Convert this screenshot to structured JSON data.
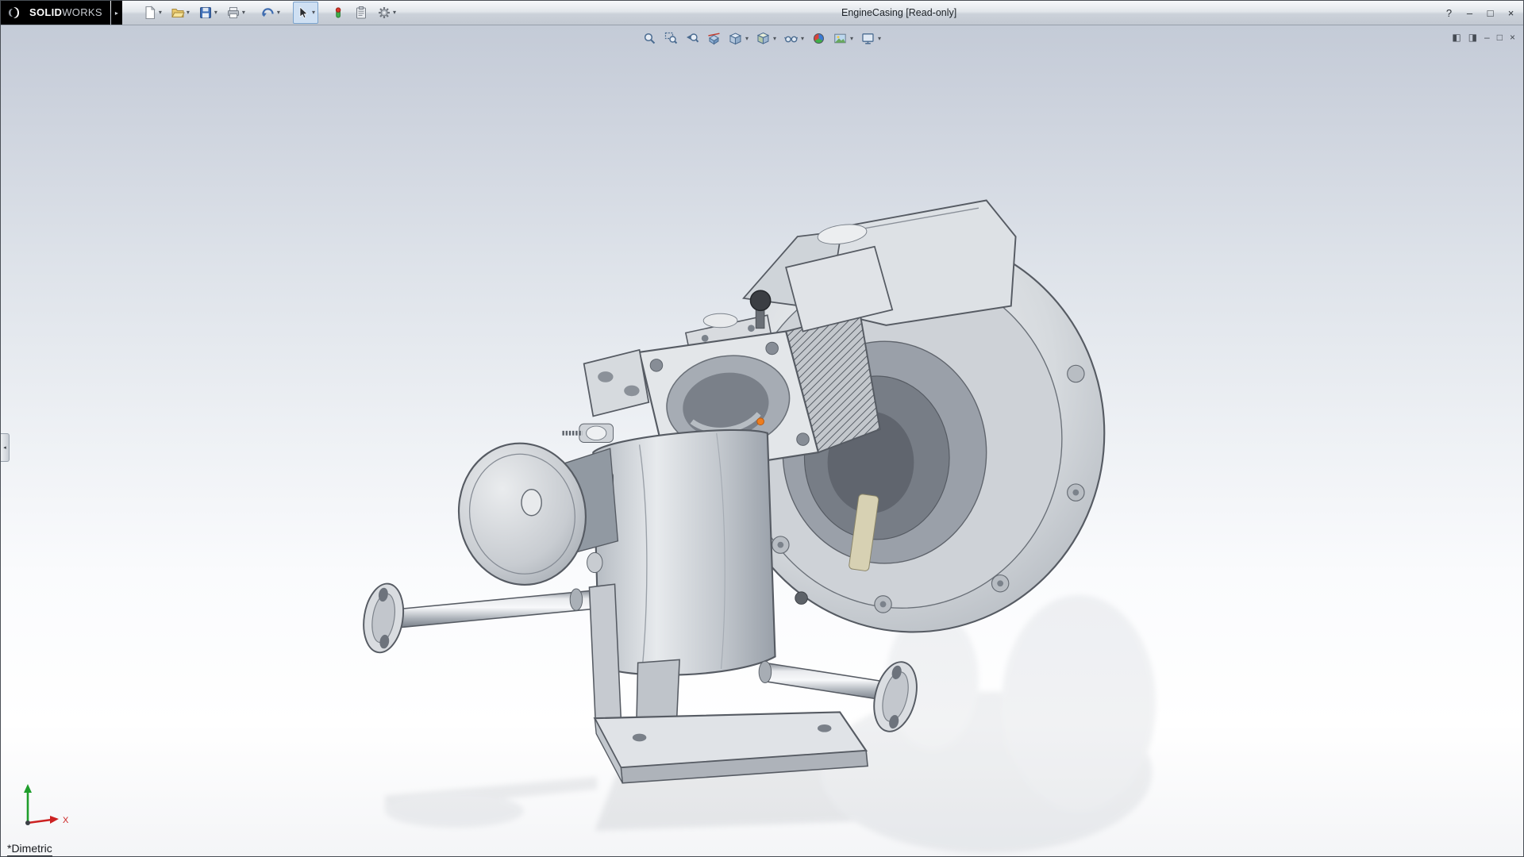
{
  "titlebar": {
    "logo_solid": "SOLID",
    "logo_works": "WORKS",
    "expander_glyph": "▸",
    "title": "EngineCasing [Read-only]",
    "help_glyph": "?",
    "minimize_glyph": "–",
    "maximize_glyph": "□",
    "close_glyph": "×"
  },
  "main_toolbar": {
    "caret_glyph": "▾",
    "items": [
      {
        "id": "new-document",
        "icon": "new-document-icon",
        "caret": true
      },
      {
        "id": "open",
        "icon": "open-folder-icon",
        "caret": true
      },
      {
        "id": "save",
        "icon": "save-floppy-icon",
        "caret": true
      },
      {
        "id": "print",
        "icon": "print-icon",
        "caret": true
      },
      {
        "id": "undo",
        "icon": "undo-arrow-icon",
        "caret": true
      },
      {
        "id": "select",
        "icon": "select-cursor-icon",
        "caret": true,
        "pressed": true
      },
      {
        "id": "rebuild",
        "icon": "rebuild-stoplight-icon",
        "caret": false
      },
      {
        "id": "file-properties",
        "icon": "file-properties-icon",
        "caret": false
      },
      {
        "id": "options",
        "icon": "options-gear-icon",
        "caret": true
      }
    ]
  },
  "heads_up_toolbar": {
    "caret_glyph": "▾",
    "items": [
      {
        "id": "zoom-to-fit",
        "icon": "zoom-to-fit-icon",
        "caret": false
      },
      {
        "id": "zoom-to-area",
        "icon": "zoom-to-area-icon",
        "caret": false
      },
      {
        "id": "previous-view",
        "icon": "previous-view-icon",
        "caret": false
      },
      {
        "id": "section-view",
        "icon": "section-view-icon",
        "caret": false
      },
      {
        "id": "view-orientation",
        "icon": "view-orientation-cube-icon",
        "caret": true
      },
      {
        "id": "display-style",
        "icon": "display-style-icon",
        "caret": true
      },
      {
        "id": "hide-show-items",
        "icon": "hide-show-glasses-icon",
        "caret": true
      },
      {
        "id": "edit-appearance",
        "icon": "edit-appearance-ball-icon",
        "caret": false
      },
      {
        "id": "apply-scene",
        "icon": "apply-scene-icon",
        "caret": true
      },
      {
        "id": "view-settings",
        "icon": "view-settings-icon",
        "caret": true
      }
    ]
  },
  "doc_controls": {
    "pane_left_glyph": "◧",
    "pane_right_glyph": "◨",
    "minimize_glyph": "–",
    "restore_glyph": "□",
    "close_glyph": "×"
  },
  "viewport": {
    "orientation_label": "*Dimetric",
    "collapsed_pane_glyph": "◂",
    "triad": {
      "x_label": "X"
    },
    "model_name": "EngineCasing assembly",
    "selection_marker_color": "#ed7d1f"
  },
  "colors": {
    "titlebar_gradient_top": "#f7f9fb",
    "titlebar_gradient_bottom": "#c3c9d2",
    "logo_background": "#000000",
    "viewport_gradient_top": "#c4cbd7",
    "viewport_gradient_bottom": "#ffffff",
    "pressed_button_fill": "#cfe0f3",
    "pressed_button_border": "#7aa2cc",
    "model_metal_light": "#e8eaec",
    "model_metal_dark": "#6f757e"
  }
}
